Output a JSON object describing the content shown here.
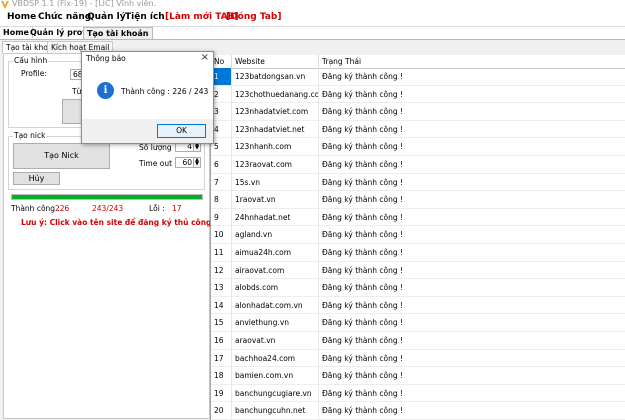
{
  "window": {
    "title": "VBDSP 1.1 (Fix-19) - [LIC] Vĩnh viễn."
  },
  "menu": [
    {
      "label": "Home",
      "red": false
    },
    {
      "label": "Chức năng",
      "red": false
    },
    {
      "label": "Quản lý",
      "red": false
    },
    {
      "label": "Tiện ích",
      "red": false
    },
    {
      "label": "[Làm mới TAB]",
      "red": true
    },
    {
      "label": "[Đóng Tab]",
      "red": true
    }
  ],
  "subtabs": [
    "Home",
    "Quản lý profile",
    "Tạo tài khoản"
  ],
  "innertabs": [
    "Tạo tài khoản",
    "Kích hoạt Email"
  ],
  "config": {
    "group_title": "Cấu hình",
    "profile_label": "Profile:",
    "profile_value": "68 -",
    "from_label": "Từ:"
  },
  "create": {
    "group_title": "Tạo nick",
    "create_button": "Tạo Nick",
    "cancel_button": "Hủy",
    "qty_label": "Số lượng",
    "qty_value": "4",
    "timeout_label": "Time out",
    "timeout_value": "60"
  },
  "stats": {
    "success_label": "Thành công :",
    "success_value": "226",
    "ratio": "243/243",
    "error_label": "Lỗi :",
    "error_value": "17"
  },
  "note": "Lưu ý: Click vào tên site để đăng ký thủ công.",
  "table": {
    "headers": [
      "No",
      "Website",
      "Trạng Thái"
    ],
    "rows": [
      [
        "1",
        "123batdongsan.vn",
        "Đăng ký thành công !"
      ],
      [
        "2",
        "123chothuedanang.com",
        "Đăng ký thành công !"
      ],
      [
        "3",
        "123nhadatviet.com",
        "Đăng ký thành công !"
      ],
      [
        "4",
        "123nhadatviet.net",
        "Đăng ký thành công !"
      ],
      [
        "5",
        "123nhanh.com",
        "Đăng ký thành công !"
      ],
      [
        "6",
        "123raovat.com",
        "Đăng ký thành công !"
      ],
      [
        "7",
        "15s.vn",
        "Đăng ký thành công !"
      ],
      [
        "8",
        "1raovat.vn",
        "Đăng ký thành công !"
      ],
      [
        "9",
        "24hnhadat.net",
        "Đăng ký thành công !"
      ],
      [
        "10",
        "agland.vn",
        "Đăng ký thành công !"
      ],
      [
        "11",
        "aimua24h.com",
        "Đăng ký thành công !"
      ],
      [
        "12",
        "airaovat.com",
        "Đăng ký thành công !"
      ],
      [
        "13",
        "alobds.com",
        "Đăng ký thành công !"
      ],
      [
        "14",
        "alonhadat.com.vn",
        "Đăng ký thành công !"
      ],
      [
        "15",
        "anviethung.vn",
        "Đăng ký thành công !"
      ],
      [
        "16",
        "araovat.vn",
        "Đăng ký thành công !"
      ],
      [
        "17",
        "bachhoa24.com",
        "Đăng ký thành công !"
      ],
      [
        "18",
        "bamien.com.vn",
        "Đăng ký thành công !"
      ],
      [
        "19",
        "banchungcugiare.vn",
        "Đăng ký thành công !"
      ],
      [
        "20",
        "banchungcuhn.net",
        "Đăng ký thành công !"
      ]
    ]
  },
  "dialog": {
    "title": "Thông báo",
    "message": "Thành công : 226 / 243",
    "ok": "OK"
  },
  "progress": {
    "fraction": 1.0
  },
  "colors": {
    "accent": "#0078d7",
    "progress": "#06b025",
    "error": "#d40000"
  }
}
